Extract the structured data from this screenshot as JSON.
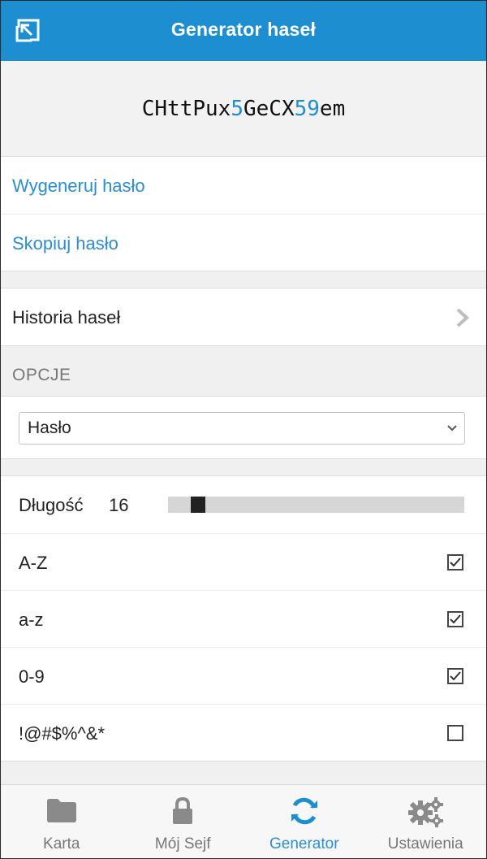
{
  "header": {
    "title": "Generator haseł"
  },
  "password": {
    "parts": [
      {
        "text": "CHttPux",
        "num": false
      },
      {
        "text": "5",
        "num": true
      },
      {
        "text": "GeCX",
        "num": false
      },
      {
        "text": "59",
        "num": true
      },
      {
        "text": "em",
        "num": false
      }
    ]
  },
  "actions": {
    "generate": "Wygeneruj hasło",
    "copy": "Skopiuj hasło"
  },
  "history": {
    "label": "Historia haseł"
  },
  "options": {
    "section_label": "OPCJE",
    "type_selected": "Hasło",
    "length_label": "Długość",
    "length_value": "16",
    "length_fraction": 0.08,
    "sets": [
      {
        "label": "A-Z",
        "checked": true
      },
      {
        "label": "a-z",
        "checked": true
      },
      {
        "label": "0-9",
        "checked": true
      },
      {
        "label": "!@#$%^&*",
        "checked": false
      }
    ]
  },
  "tabs": [
    {
      "label": "Karta",
      "icon": "folder-icon",
      "active": false
    },
    {
      "label": "Mój Sejf",
      "icon": "lock-icon",
      "active": false
    },
    {
      "label": "Generator",
      "icon": "refresh-icon",
      "active": true
    },
    {
      "label": "Ustawienia",
      "icon": "gears-icon",
      "active": false
    }
  ],
  "colors": {
    "accent": "#1d8fd1",
    "link": "#2b8ed3"
  }
}
